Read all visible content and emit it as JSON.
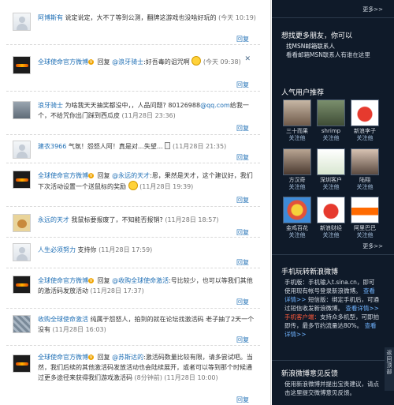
{
  "comments": [
    {
      "name": "阿博斯有",
      "verified": false,
      "text": "说定说定，大不了等到公测，翻牌这游戏也没啥好玩的",
      "time": "(今天 10:19)",
      "reply": "回复",
      "avatar": "user"
    },
    {
      "name": "全球使命官方微博",
      "verified": true,
      "prefix": "回复",
      "mention": "@浪牙骑士",
      "text": ":好吾毒的诅咒啊",
      "time": "(今天 09:38)",
      "reply": "回复",
      "avatar": "game"
    },
    {
      "name": "浪牙骑士",
      "verified": false,
      "text": "为啥我天天抽奖都没中，，人品问题? 80126988",
      "mention": "@qq.com",
      "text2": "给我一个，不给咒你出门踩到西瓜皮",
      "time": "(11月28日 23:36)",
      "reply": "回复",
      "avatar": "photo"
    },
    {
      "name": "建衣3966",
      "verified": false,
      "text": "气氛！怨怒人阿！真是对…失望…",
      "time": "(11月28日 21:35)",
      "reply": "回复",
      "avatar": "user"
    },
    {
      "name": "全球使命官方微博",
      "verified": true,
      "prefix": "回复",
      "mention": "@永远的天才",
      "text": ":恩，果然是天才，这个建议好，我们下次活动设置一个送鼠标的奖励",
      "time": "(11月28日 19:39)",
      "reply": "回复",
      "avatar": "game"
    },
    {
      "name": "永远的天才",
      "verified": false,
      "text": "我鼠标要报废了，不知能否报销?",
      "time": "(11月28日 18:57)",
      "reply": "回复",
      "avatar": "cat"
    },
    {
      "name": "人生必须努力",
      "verified": false,
      "text": "支持你",
      "time": "(11月28日 17:59)",
      "reply": "回复",
      "avatar": "user"
    },
    {
      "name": "全球使命官方微博",
      "verified": true,
      "prefix": "回复",
      "mention": "@收购全球使命激活",
      "text": ":号比较少，也可以等我们其他的激活码发放活动",
      "time": "(11月28日 17:37)",
      "reply": "回复",
      "avatar": "game"
    },
    {
      "name": "收购全球使命激活",
      "verified": false,
      "text": "纯属于怨怒人，拍到的就在论坛找激活码 老子抽了2天一个没有",
      "time": "(11月28日 16:03)",
      "reply": "回复",
      "avatar": "pattern"
    },
    {
      "name": "全球使命官方微博",
      "verified": true,
      "prefix": "回复",
      "mention": "@苏斯达的",
      "text": ":激活码数量比较有限，请多尝试吧。当然，我们后续的其他激活码发放活动也会陆续展开，或者可以等到那个时候通过更多途径来获得我们游戏激活码",
      "time": "(8分钟前) (11月28日 10:00)",
      "reply": "回复",
      "avatar": "game"
    }
  ],
  "sidebar": {
    "more_top": "更多>>",
    "find_friends_title": "想找更多朋友，你可以",
    "find_friends_line1": "找MSN邮箱联系人",
    "find_friends_line2": "看看邮箱MSN联系人有谁在这里",
    "popular_title": "人气用户推荐",
    "users": [
      {
        "name": "三十而果",
        "action": "关注他"
      },
      {
        "name": "shrimp",
        "action": "关注他"
      },
      {
        "name": "新浪李子",
        "action": "关注他"
      },
      {
        "name": "方汉奇",
        "action": "关注他"
      },
      {
        "name": "深圳客户",
        "action": "关注他"
      },
      {
        "name": "陆翔",
        "action": "关注他"
      },
      {
        "name": "金鸡百花",
        "action": "关注他"
      },
      {
        "name": "新浪财经",
        "action": "关注他"
      },
      {
        "name": "阿里巴巴",
        "action": "关注他"
      }
    ],
    "more_users": "更多>>",
    "mobile_title": "手机玩转新浪微博",
    "mobile_text1": "手机版：手机输入t.sina.cn，即可使用现有帐号登录新浪微博。",
    "mobile_link1": "查看详情>>",
    "mobile_text2": "短信版：绑定手机后，可通过短信收发新浪微博。",
    "mobile_link2": "查看详情>>",
    "mobile_text3_hl": "手机客户端：",
    "mobile_text3": "支持众多机型，可即拍即传，最多节约流量达80%。",
    "mobile_link3": "查看详情>>",
    "feedback_title": "新浪微博意见反馈",
    "feedback_text": "使用新浪微博并提出宝贵建议，请点击这里提交微博意见反馈。",
    "back_to_top": "返回顶部"
  }
}
